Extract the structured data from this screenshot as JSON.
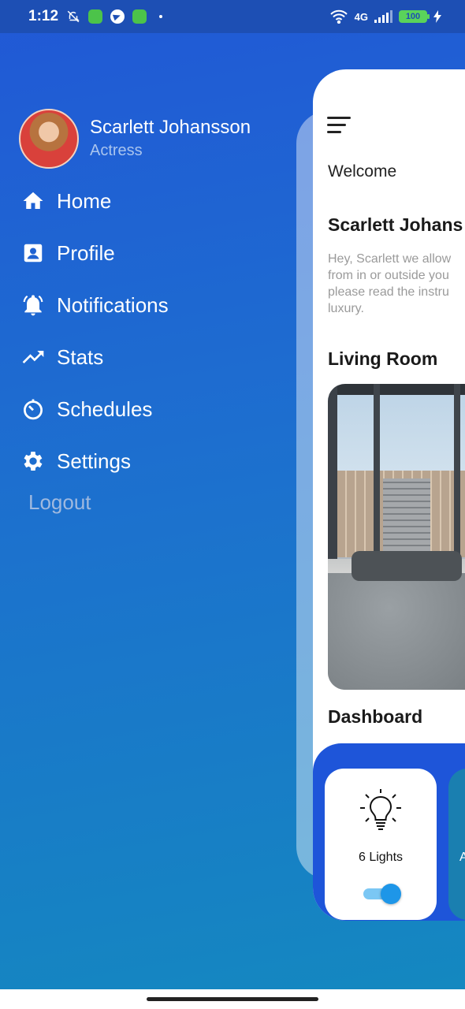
{
  "status_bar": {
    "time": "1:12",
    "network": "4G",
    "battery": "100"
  },
  "drawer": {
    "profile": {
      "name": "Scarlett Johansson",
      "role": "Actress"
    },
    "menu": [
      {
        "label": "Home",
        "icon": "home-icon"
      },
      {
        "label": "Profile",
        "icon": "profile-card-icon"
      },
      {
        "label": "Notifications",
        "icon": "bell-icon"
      },
      {
        "label": "Stats",
        "icon": "trending-up-icon"
      },
      {
        "label": "Schedules",
        "icon": "timer-icon"
      },
      {
        "label": "Settings",
        "icon": "gear-icon"
      }
    ],
    "logout_label": "Logout"
  },
  "main": {
    "welcome": "Welcome",
    "user_name": "Scarlett Johans",
    "intro_lines": [
      "Hey, Scarlett we allow",
      "from in or outside you",
      "please read the instru",
      "luxury."
    ],
    "room_title": "Living Room",
    "dashboard_title": "Dashboard",
    "devices": [
      {
        "label": "6 Lights",
        "icon": "lightbulb-icon",
        "on": true
      },
      {
        "label": "A",
        "icon": "unknown"
      }
    ]
  },
  "colors": {
    "background_top": "#2158d6",
    "background_bottom": "#1488c0",
    "dashboard_panel": "#1e55d9",
    "toggle_on": "#1e96e8"
  }
}
